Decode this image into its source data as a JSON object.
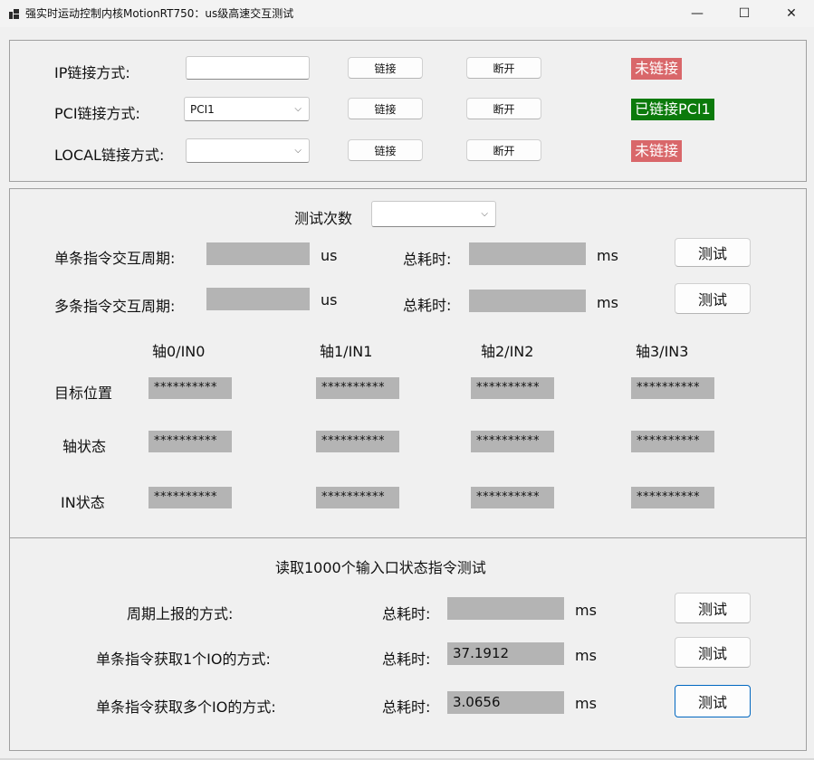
{
  "window": {
    "title": "强实时运动控制内核MotionRT750：us级高速交互测试",
    "minimize": "—",
    "maximize": "☐",
    "close": "✕"
  },
  "connection": {
    "ip_label": "IP链接方式:",
    "ip_value": "",
    "pci_label": "PCI链接方式:",
    "pci_selected": "PCI1",
    "local_label": "LOCAL链接方式:",
    "local_selected": "",
    "connect_label": "链接",
    "disconnect_label": "断开",
    "ip_status": "未链接",
    "pci_status": "已链接PCI1",
    "local_status": "未链接"
  },
  "test": {
    "count_label": "测试次数",
    "count_selected": "",
    "single_cycle_label": "单条指令交互周期:",
    "multi_cycle_label": "多条指令交互周期:",
    "us_unit": "us",
    "total_label": "总耗时:",
    "ms_unit": "ms",
    "test_button": "测试",
    "single_cycle_value": "",
    "single_total_value": "",
    "multi_cycle_value": "",
    "multi_total_value": "",
    "columns": [
      "轴0/IN0",
      "轴1/IN1",
      "轴2/IN2",
      "轴3/IN3"
    ],
    "rows": [
      {
        "label": "目标位置",
        "values": [
          "**********",
          "**********",
          "**********",
          "**********"
        ]
      },
      {
        "label": "轴状态",
        "values": [
          "**********",
          "**********",
          "**********",
          "**********"
        ]
      },
      {
        "label": "IN状态",
        "values": [
          "**********",
          "**********",
          "**********",
          "**********"
        ]
      }
    ]
  },
  "io_test": {
    "title": "读取1000个输入口状态指令测试",
    "total_label": "总耗时:",
    "ms_unit": "ms",
    "test_button": "测试",
    "items": [
      {
        "label": "周期上报的方式:",
        "value": ""
      },
      {
        "label": "单条指令获取1个IO的方式:",
        "value": "37.1912"
      },
      {
        "label": "单条指令获取多个IO的方式:",
        "value": "3.0656"
      }
    ]
  }
}
